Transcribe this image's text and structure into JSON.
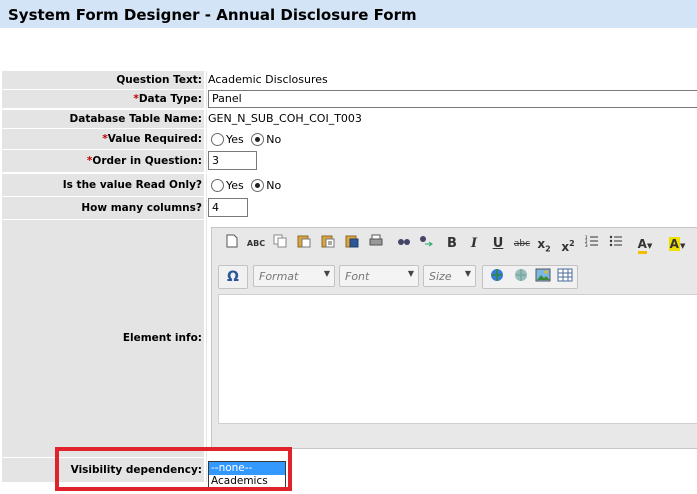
{
  "header": {
    "title": "System Form Designer - Annual Disclosure Form"
  },
  "form": {
    "question_text": {
      "label": "Question Text:",
      "value": "Academic Disclosures"
    },
    "data_type": {
      "required_mark": "*",
      "label": "Data Type:",
      "value": "Panel"
    },
    "db_table": {
      "label": "Database Table Name:",
      "value": "GEN_N_SUB_COH_COI_T003"
    },
    "value_required": {
      "required_mark": "*",
      "label": "Value Required:",
      "yes": "Yes",
      "no": "No",
      "selected": "No"
    },
    "order": {
      "required_mark": "*",
      "label": "Order in Question:",
      "value": "3"
    },
    "read_only": {
      "label": "Is the value Read Only?",
      "yes": "Yes",
      "no": "No",
      "selected": "No"
    },
    "columns": {
      "label": "How many columns?",
      "value": "4"
    },
    "element_info": {
      "label": "Element info:"
    },
    "visibility": {
      "label": "Visibility dependency:",
      "options": [
        "--none--",
        "Academics"
      ],
      "selected": "--none--"
    }
  },
  "editor": {
    "toolbar1": [
      "new-page-icon",
      "spellcheck-icon",
      "copy-icon",
      "paste-icon",
      "paste-text-icon",
      "paste-word-icon",
      "print-icon",
      "find-icon",
      "replace-icon",
      "bold-icon",
      "italic-icon",
      "underline-icon",
      "strike-icon",
      "subscript-icon",
      "superscript-icon",
      "numbered-list-icon",
      "bullet-list-icon",
      "text-color-icon",
      "bg-color-icon"
    ],
    "format_label": "Format",
    "font_label": "Font",
    "size_label": "Size"
  },
  "colors": {
    "title_bar": "#d4e4f7",
    "label_bg": "#e4e4e4",
    "required": "#c00000",
    "highlight": "#e0222b",
    "selection": "#3399ff"
  }
}
